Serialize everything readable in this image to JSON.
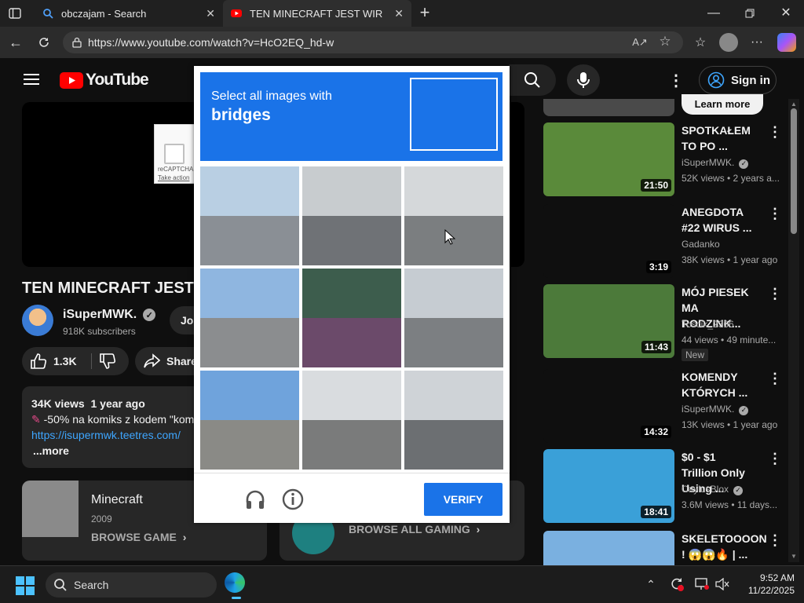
{
  "browser": {
    "tabs": [
      {
        "label": "obczajam - Search",
        "active": false
      },
      {
        "label": "TEN MINECRAFT JEST WIRUSEM",
        "active": true
      }
    ],
    "url": "https://www.youtube.com/watch?v=HcO2EQ_hd-w"
  },
  "youtube": {
    "logo_text": "YouTube",
    "sign_in": "Sign in",
    "video_title": "TEN MINECRAFT JEST W",
    "channel": {
      "name": "iSuperMWK.",
      "subscribers": "918K subscribers",
      "join_label": "Jo"
    },
    "actions": {
      "likes": "1.3K",
      "share": "Share"
    },
    "recaptcha_small": {
      "label": "reCAPTCHA",
      "sub": "Take action"
    },
    "description": {
      "views": "34K views",
      "date": "1 year ago",
      "line1": "-50% na komiks z kodem \"kom",
      "link": "https://isupermwk.teetres.com/",
      "more": "...more"
    },
    "game_card": {
      "title": "Minecraft",
      "year": "2009",
      "browse": "BROWSE GAME"
    },
    "gaming_card": {
      "browse": "BROWSE ALL GAMING"
    },
    "learn_more": "Learn more",
    "recommended": [
      {
        "title": "SPOTKAŁEM TO PO ...",
        "channel": "iSuperMWK.",
        "verified": true,
        "meta": "52K views • 2 years a...",
        "duration": "21:50",
        "thumb_color": "#5a8a3a"
      },
      {
        "title": "ANEGDOTA #22 WIRUS ...",
        "channel": "Gadanko",
        "verified": false,
        "meta": "38K views • 1 year ago",
        "duration": "3:19",
        "thumb_color": "#0f0f0f"
      },
      {
        "title": "MÓJ PIESEK MA RODZINK...",
        "channel": "Toscik_2366",
        "verified": false,
        "meta": "44 views • 49 minute...",
        "badge": "New",
        "duration": "11:43",
        "thumb_color": "#4c7a3a"
      },
      {
        "title": "KOMENDY KTÓRYCH ...",
        "channel": "iSuperMWK.",
        "verified": true,
        "meta": "13K views • 1 year ago",
        "duration": "14:32",
        "thumb_color": "#0f0f0f"
      },
      {
        "title": "$0 - $1 Trillion Only Using ...",
        "channel": "CaylusBlox",
        "verified": true,
        "meta": "3.6M views • 11 days...",
        "duration": "18:41",
        "thumb_color": "#3aa0d8"
      },
      {
        "title": "SKELETOOOON ! 😱😱🔥 | ...",
        "channel": "",
        "verified": false,
        "meta": "",
        "duration": "",
        "thumb_color": "#7ab0e0"
      }
    ]
  },
  "captcha": {
    "instruction": "Select all images with",
    "target": "bridges",
    "verify": "VERIFY",
    "tiles": [
      {
        "name": "tile-railing-crane",
        "sky": "#b9cfe3",
        "ground": "#8a8f95"
      },
      {
        "name": "tile-road-overpass",
        "sky": "#c8cccf",
        "ground": "#6f7276"
      },
      {
        "name": "tile-elevated-highway",
        "sky": "#d5d8da",
        "ground": "#7b7e80"
      },
      {
        "name": "tile-street-buildings",
        "sky": "#8fb6e0",
        "ground": "#8b8d8f"
      },
      {
        "name": "tile-blurry-road",
        "sky": "#3d5d4d",
        "ground": "#6b4a6a"
      },
      {
        "name": "tile-road-white-car",
        "sky": "#c6ccd2",
        "ground": "#7c7f82"
      },
      {
        "name": "tile-overpass-highway",
        "sky": "#6fa3dc",
        "ground": "#8a8a86"
      },
      {
        "name": "tile-concrete-pillar",
        "sky": "#d9dcdf",
        "ground": "#7a7b7b"
      },
      {
        "name": "tile-highway-poles",
        "sky": "#cfd3d7",
        "ground": "#6c6f72"
      }
    ]
  },
  "taskbar": {
    "search": "Search",
    "time": "9:52 AM",
    "date": "11/22/2025"
  },
  "colors": {
    "accent": "#1a73e8",
    "yt_red": "#ff0000",
    "edge_blue": "#1ea3e8"
  }
}
